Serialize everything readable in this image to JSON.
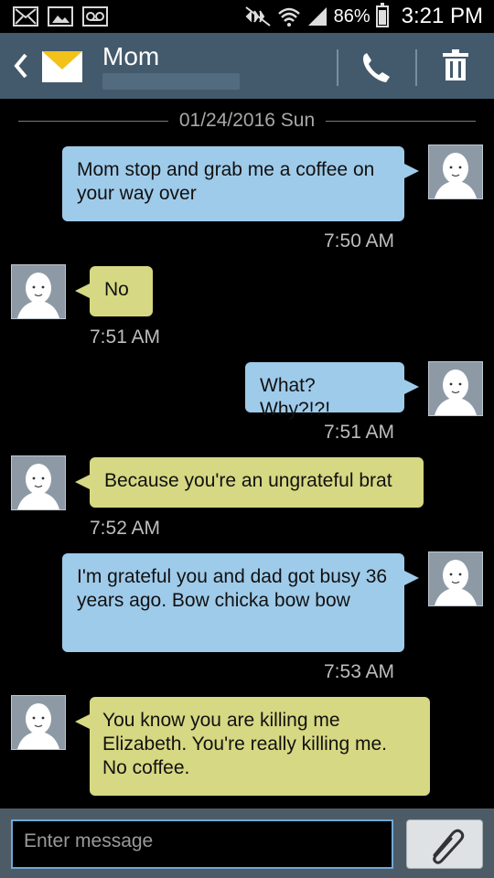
{
  "status_bar": {
    "battery": "86%",
    "time": "3:21 PM",
    "icons": [
      "mail-icon",
      "image-icon",
      "voicemail-icon",
      "mute-icon",
      "wifi-icon",
      "signal-icon",
      "battery-icon"
    ]
  },
  "header": {
    "contact_name": "Mom",
    "icons": [
      "back-icon",
      "envelope-icon",
      "phone-icon",
      "trash-icon"
    ]
  },
  "conversation": {
    "date": "01/24/2016 Sun",
    "messages": [
      {
        "direction": "out",
        "text": "Mom stop and grab me a coffee on your way over",
        "time": "7:50 AM"
      },
      {
        "direction": "in",
        "text": "No",
        "time": "7:51 AM"
      },
      {
        "direction": "out",
        "text": "What? Why?!?!",
        "time": "7:51 AM"
      },
      {
        "direction": "in",
        "text": "Because you're an ungrateful brat",
        "time": "7:52 AM"
      },
      {
        "direction": "out",
        "text": "I'm grateful you and dad got busy 36 years ago. Bow chicka bow bow",
        "time": "7:53 AM"
      },
      {
        "direction": "in",
        "text": "You know you are killing me Elizabeth. You're really killing me. No coffee.",
        "time": ""
      }
    ]
  },
  "composer": {
    "placeholder": "Enter message"
  },
  "colors": {
    "header_bg": "#435a6c",
    "outgoing_bubble": "#9fcbea",
    "incoming_bubble": "#d6d883",
    "composer_bg": "#4d5b66",
    "input_border": "#6fa8d6"
  }
}
